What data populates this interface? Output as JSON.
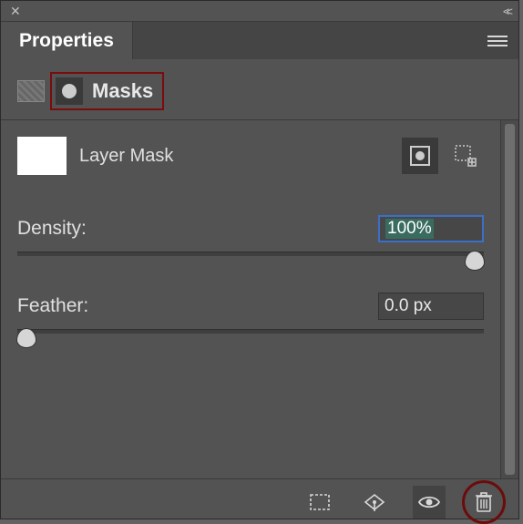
{
  "panel": {
    "title": "Properties"
  },
  "header": {
    "masks_label": "Masks"
  },
  "mask": {
    "name": "Layer Mask"
  },
  "sliders": {
    "density": {
      "label": "Density:",
      "value": "100%",
      "pos": 100
    },
    "feather": {
      "label": "Feather:",
      "value": "0.0 px",
      "pos": 0
    }
  }
}
